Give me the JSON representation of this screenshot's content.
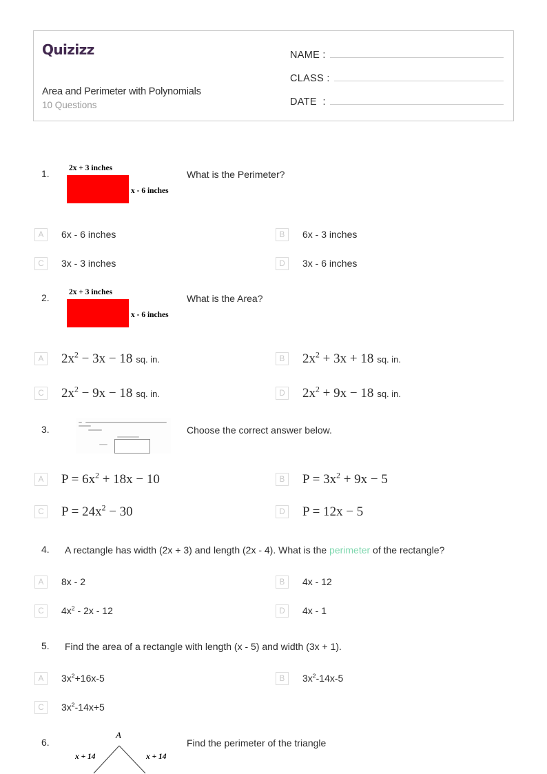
{
  "header": {
    "logo_text": "Quizizz",
    "title": "Area and Perimeter with Polynomials",
    "subtitle": "10 Questions",
    "fields": [
      {
        "label": "NAME :",
        "value": ""
      },
      {
        "label": "CLASS :",
        "value": ""
      },
      {
        "label": "DATE  :",
        "value": ""
      }
    ]
  },
  "colors": {
    "brand_purple": "#42294f",
    "highlight_green": "#7ed7ae",
    "figure_red": "#ff0000",
    "option_box_border": "#dcdcdc",
    "option_letter": "#c9c9c9"
  },
  "questions": [
    {
      "number": "1.",
      "prompt": "What is the Perimeter?",
      "figure": {
        "type": "rectangle",
        "top_label": "2x + 3 inches",
        "side_label": "x - 6 inches"
      },
      "options": [
        {
          "letter": "A",
          "text": "6x - 6 inches"
        },
        {
          "letter": "B",
          "text": "6x - 3 inches"
        },
        {
          "letter": "C",
          "text": "3x - 3 inches"
        },
        {
          "letter": "D",
          "text": "3x - 6 inches"
        }
      ]
    },
    {
      "number": "2.",
      "prompt": "What is the Area?",
      "figure": {
        "type": "rectangle",
        "top_label": "2x + 3 inches",
        "side_label": "x - 6 inches"
      },
      "options": [
        {
          "letter": "A",
          "coef": "2x",
          "exp": "2",
          "rest": " − 3x − 18",
          "unit": "sq. in."
        },
        {
          "letter": "B",
          "coef": "2x",
          "exp": "2",
          "rest": " + 3x + 18",
          "unit": "sq. in."
        },
        {
          "letter": "C",
          "coef": "2x",
          "exp": "2",
          "rest": " − 9x − 18",
          "unit": "sq. in."
        },
        {
          "letter": "D",
          "coef": "2x",
          "exp": "2",
          "rest": " + 9x − 18",
          "unit": "sq. in."
        }
      ]
    },
    {
      "number": "3.",
      "prompt": "Choose the correct answer below.",
      "figure": {
        "type": "thumbnail",
        "description": "screenshot of a textbook problem showing a rectangle diagram with labelled length and width"
      },
      "options": [
        {
          "letter": "A",
          "coef": "P = 6x",
          "exp": "2",
          "rest": " + 18x − 10",
          "unit": ""
        },
        {
          "letter": "B",
          "coef": "P = 3x",
          "exp": "2",
          "rest": " + 9x − 5",
          "unit": ""
        },
        {
          "letter": "C",
          "coef": "P = 24x",
          "exp": "2",
          "rest": " − 30",
          "unit": ""
        },
        {
          "letter": "D",
          "coef": "P = 12x − 5",
          "exp": "",
          "rest": "",
          "unit": ""
        }
      ]
    },
    {
      "number": "4.",
      "prompt_before": "A rectangle has width (2x + 3) and length (2x - 4).  What is the ",
      "prompt_highlight": "perimeter",
      "prompt_after": " of the rectangle?",
      "options": [
        {
          "letter": "A",
          "pre": "8x - 2",
          "exp": "",
          "post": ""
        },
        {
          "letter": "B",
          "pre": "4x - 12",
          "exp": "",
          "post": ""
        },
        {
          "letter": "C",
          "pre": "4x",
          "exp": "2",
          "post": " - 2x - 12"
        },
        {
          "letter": "D",
          "pre": "4x - 1",
          "exp": "",
          "post": ""
        }
      ]
    },
    {
      "number": "5.",
      "prompt": "Find the area of a rectangle with length (x - 5) and width (3x + 1).",
      "options": [
        {
          "letter": "A",
          "pre": "3x",
          "exp": "2",
          "post": "+16x-5"
        },
        {
          "letter": "B",
          "pre": "3x",
          "exp": "2",
          "post": "-14x-5"
        },
        {
          "letter": "C",
          "pre": "3x",
          "exp": "2",
          "post": "-14x+5"
        }
      ]
    },
    {
      "number": "6.",
      "prompt": "Find the perimeter of the triangle",
      "figure": {
        "type": "triangle",
        "apex_label": "A",
        "left_side_label": "x + 14",
        "right_side_label": "x + 14"
      }
    }
  ]
}
